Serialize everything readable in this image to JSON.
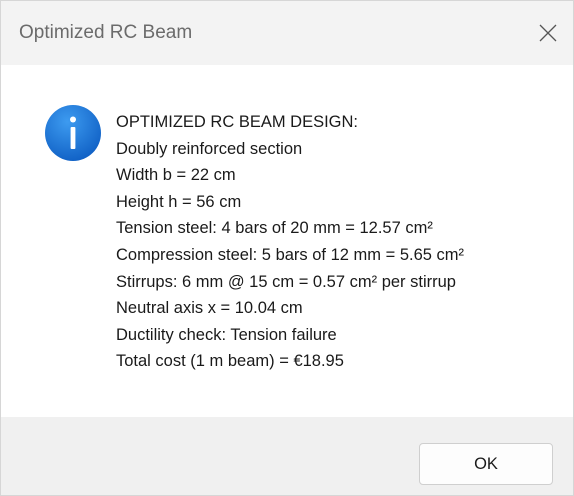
{
  "window": {
    "title": "Optimized RC Beam",
    "close_icon": "close-icon"
  },
  "message": {
    "icon": "info-icon",
    "icon_color": "#1a73d9",
    "lines": [
      "OPTIMIZED RC BEAM DESIGN:",
      "Doubly reinforced section",
      "Width b = 22 cm",
      "Height h = 56 cm",
      "Tension steel: 4 bars of 20 mm = 12.57 cm²",
      "Compression steel: 5 bars of 12 mm = 5.65 cm²",
      "Stirrups: 6 mm @ 15 cm = 0.57 cm² per stirrup",
      "Neutral axis x = 10.04 cm",
      "Ductility check: Tension failure",
      "Total cost (1 m beam) = €18.95"
    ]
  },
  "footer": {
    "ok_label": "OK"
  }
}
